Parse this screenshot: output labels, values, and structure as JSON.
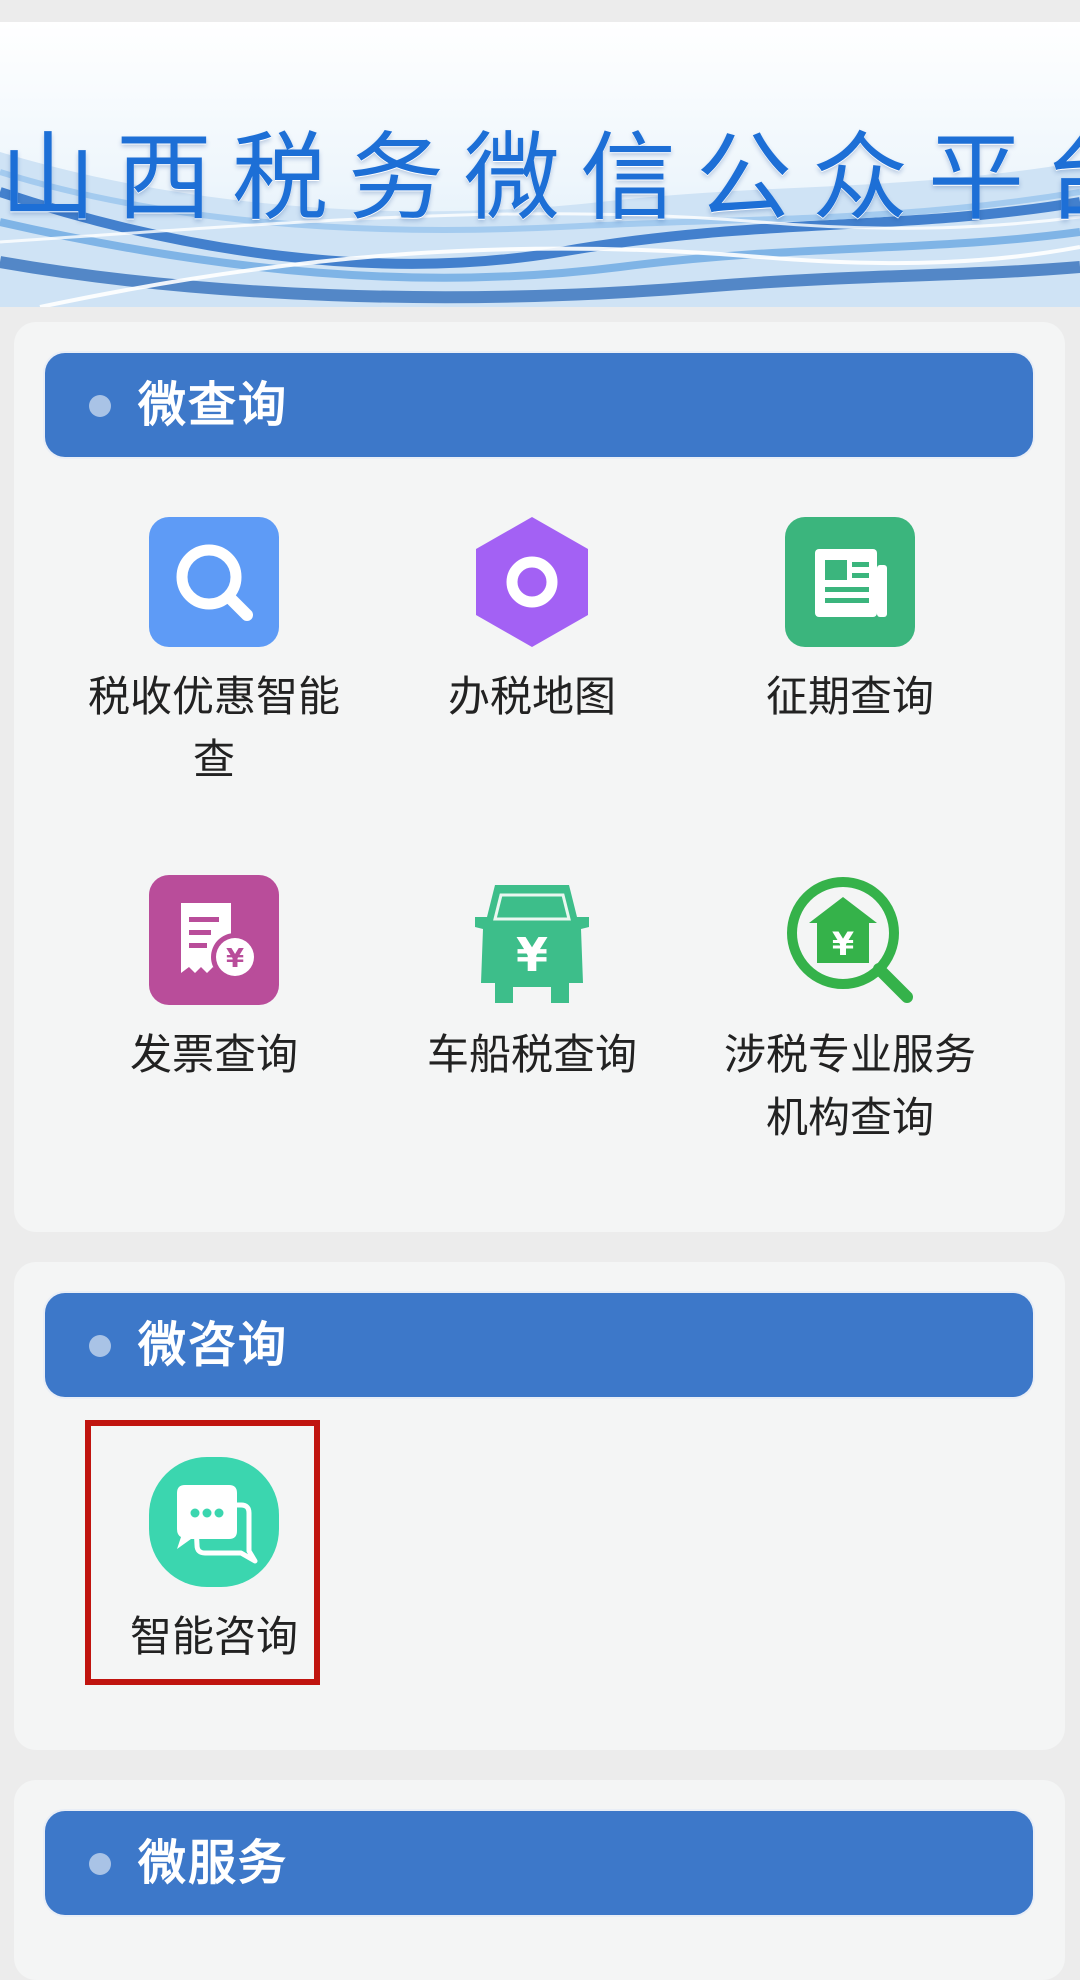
{
  "banner": {
    "title": "山西税务微信公众平台"
  },
  "sections": [
    {
      "title": "微查询",
      "items": [
        {
          "label": "税收优惠智能查",
          "icon": "search-icon"
        },
        {
          "label": "办税地图",
          "icon": "map-hexagon-icon"
        },
        {
          "label": "征期查询",
          "icon": "calendar-document-icon"
        },
        {
          "label": "发票查询",
          "icon": "invoice-icon"
        },
        {
          "label": "车船税查询",
          "icon": "car-tax-icon"
        },
        {
          "label": "涉税专业服务机构查询",
          "icon": "agency-search-icon"
        }
      ]
    },
    {
      "title": "微咨询",
      "items": [
        {
          "label": "智能咨询",
          "icon": "chat-bubbles-icon"
        }
      ]
    },
    {
      "title": "微服务",
      "items": []
    }
  ],
  "colors": {
    "header_blue": "#3d78c9",
    "card_bg": "#f4f5f5",
    "page_bg": "#ececec",
    "highlight_red": "#c0140f"
  }
}
